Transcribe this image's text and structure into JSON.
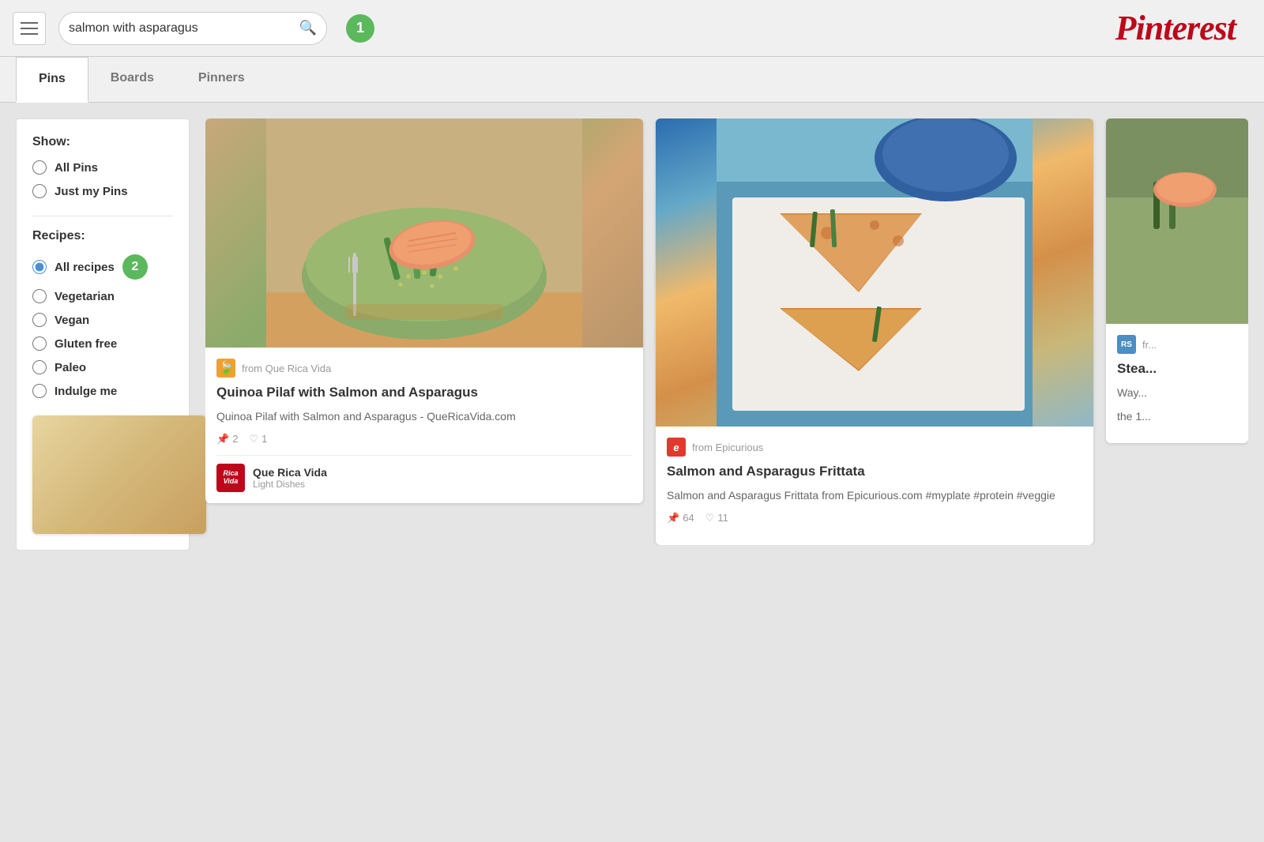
{
  "header": {
    "menu_label": "Menu",
    "search_value": "salmon with asparagus",
    "search_placeholder": "Search",
    "badge1_value": "1",
    "logo_text": "Pinterest"
  },
  "tabs": [
    {
      "id": "pins",
      "label": "Pins",
      "active": true
    },
    {
      "id": "boards",
      "label": "Boards",
      "active": false
    },
    {
      "id": "pinners",
      "label": "Pinners",
      "active": false
    }
  ],
  "sidebar": {
    "show_title": "Show:",
    "show_options": [
      {
        "id": "all-pins",
        "label": "All Pins",
        "checked": false
      },
      {
        "id": "just-my-pins",
        "label": "Just my Pins",
        "checked": false
      }
    ],
    "recipes_title": "Recipes:",
    "recipes_options": [
      {
        "id": "all-recipes",
        "label": "All recipes",
        "checked": true
      },
      {
        "id": "vegetarian",
        "label": "Vegetarian",
        "checked": false
      },
      {
        "id": "vegan",
        "label": "Vegan",
        "checked": false
      },
      {
        "id": "gluten-free",
        "label": "Gluten free",
        "checked": false
      },
      {
        "id": "paleo",
        "label": "Paleo",
        "checked": false
      },
      {
        "id": "indulge-me",
        "label": "Indulge me",
        "checked": false
      }
    ],
    "badge2_value": "2"
  },
  "cards": [
    {
      "id": "card-1",
      "source_name": "from Que Rica Vida",
      "source_icon_color": "#f0a030",
      "source_icon_text": "🍃",
      "title": "Quinoa Pilaf with Salmon and Asparagus",
      "description": "Quinoa Pilaf with Salmon and Asparagus - QueRicaVida.com",
      "stats_pin": "2",
      "stats_heart": "1",
      "footer_logo_line1": "Rica",
      "footer_logo_line2": "Vida",
      "footer_name": "Que Rica Vida",
      "footer_sub": "Light Dishes"
    },
    {
      "id": "card-2",
      "source_name": "from Epicurious",
      "source_icon_color": "#e03a2e",
      "source_icon_letter": "e",
      "title": "Salmon and Asparagus Frittata",
      "description": "Salmon and Asparagus Frittata from Epicurious.com #myplate #protein #veggie",
      "stats_pin": "64",
      "stats_heart": "11"
    },
    {
      "id": "card-3-partial",
      "source_name_short": "RS",
      "source_icon_color": "#4a8ec2",
      "title_partial": "Stea",
      "desc_partial": "Way",
      "desc_partial2": "the 1"
    }
  ],
  "colors": {
    "accent": "#bd081c",
    "badge_green": "#5cb85c",
    "tab_active_bg": "#ffffff"
  }
}
